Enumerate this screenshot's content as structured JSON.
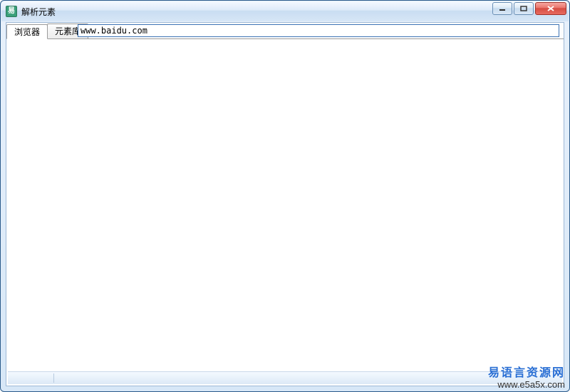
{
  "window": {
    "title": "解析元素",
    "icon_glyph": "易"
  },
  "tabs": {
    "items": [
      {
        "label": "浏览器",
        "active": true
      },
      {
        "label": "元素库",
        "active": false
      }
    ]
  },
  "url": {
    "value": "www.baidu.com"
  },
  "watermark": {
    "line1": "易语言资源网",
    "line2": "www.e5a5x.com"
  }
}
